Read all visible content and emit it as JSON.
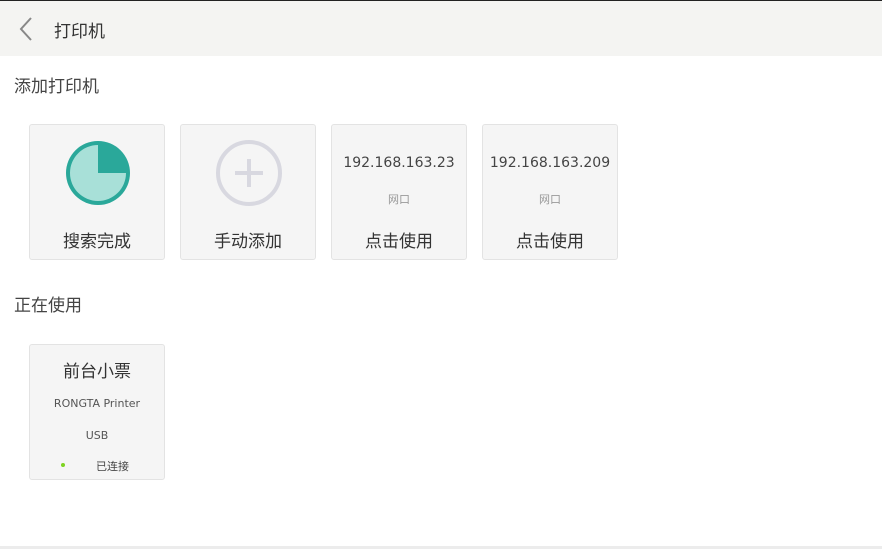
{
  "header": {
    "title": "打印机",
    "back_icon": "chevron-left-icon"
  },
  "sections": {
    "add": "添加打印机",
    "in_use": "正在使用"
  },
  "add_cards": {
    "search": {
      "label": "搜索完成",
      "icon": "progress-pie-icon",
      "accent": "#2aa89a"
    },
    "manual": {
      "label": "手动添加",
      "icon": "plus-circle-icon"
    },
    "ip1": {
      "ip": "192.168.163.23",
      "conn": "网口",
      "action": "点击使用"
    },
    "ip2": {
      "ip": "192.168.163.209",
      "conn": "网口",
      "action": "点击使用"
    }
  },
  "in_use_card": {
    "name": "前台小票",
    "model": "RONGTA Printer",
    "port": "USB",
    "status": "已连接",
    "status_color": "#7ed321"
  }
}
